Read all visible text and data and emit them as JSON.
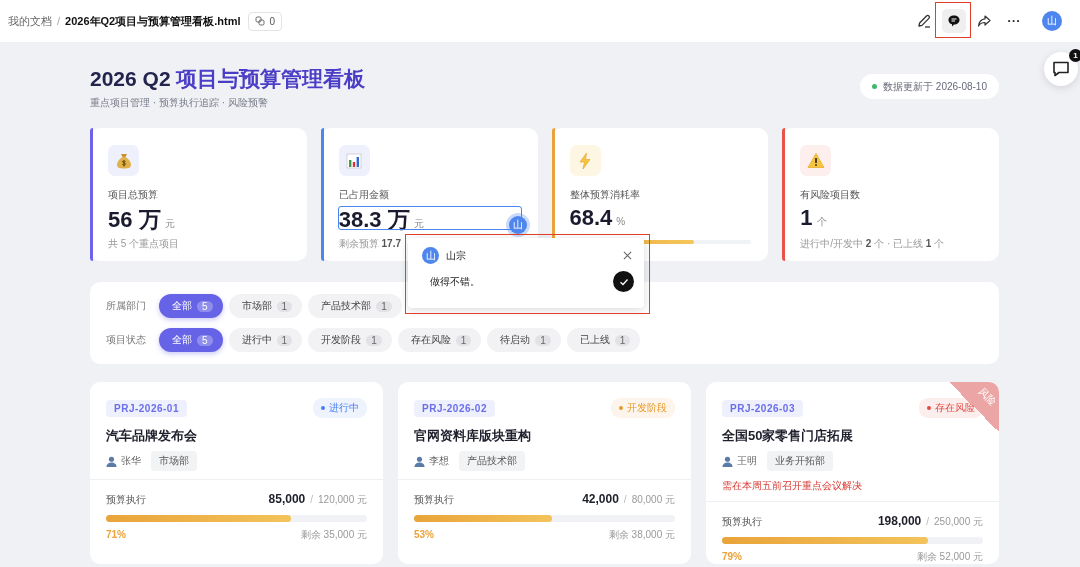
{
  "topbar": {
    "breadcrumb_root": "我的文档",
    "separator": "/",
    "file_name": "2026年Q2项目与预算管理看板.html",
    "link_count": "0",
    "tools": [
      {
        "kind": "edit",
        "selected": false
      },
      {
        "kind": "comment",
        "selected": true
      },
      {
        "kind": "share",
        "selected": false
      },
      {
        "kind": "more",
        "selected": false
      }
    ],
    "avatar": "山"
  },
  "comment_fab": {
    "badge": "1"
  },
  "header": {
    "title_part1": "2026 Q2",
    "title_part2": "项目与预算管理看板",
    "subtitle": "重点项目管理 · 预算执行追踪 · 风险预警",
    "updated": "数据更新于 2026-08-10"
  },
  "kpis": [
    {
      "color": "#6c63e8",
      "label": "项目总预算",
      "value": "56 万",
      "unit": "元",
      "sub": "共 5 个重点项目"
    },
    {
      "color": "#4a86f0",
      "label": "已占用金额",
      "value": "38.3 万",
      "unit": "元",
      "sub": "剩余预算 **17.7**",
      "commented": true
    },
    {
      "color": "#eba23a",
      "label": "整体预算消耗率",
      "value": "68.4",
      "unit": "%",
      "level": 0.684
    },
    {
      "color": "#e5534b",
      "label": "有风险项目数",
      "value": "1",
      "unit": "个",
      "sub": "进行中/开发中 **2** 个 · 已上线 **1** 个"
    }
  ],
  "filters": [
    {
      "label": "所属部门",
      "chips": [
        {
          "label": "全部",
          "count": "5",
          "selected": true
        },
        {
          "label": "市场部",
          "count": "1",
          "selected": false
        },
        {
          "label": "产品技术部",
          "count": "1",
          "selected": false
        }
      ]
    },
    {
      "label": "项目状态",
      "chips": [
        {
          "label": "全部",
          "count": "5",
          "selected": true
        },
        {
          "label": "进行中",
          "count": "1",
          "selected": false
        },
        {
          "label": "开发阶段",
          "count": "1",
          "selected": false
        },
        {
          "label": "存在风险",
          "count": "1",
          "selected": false
        },
        {
          "label": "待启动",
          "count": "1",
          "selected": false
        },
        {
          "label": "已上线",
          "count": "1",
          "selected": false
        }
      ]
    }
  ],
  "projects": [
    {
      "id": "PRJ-2026-01",
      "status": "进行中",
      "color": "#4a7ef0",
      "title": "汽车品牌发布会",
      "owner": "张华",
      "dept": "市场部",
      "budget_label": "预算执行",
      "spent": "85,000",
      "slash": "/",
      "total": "120,000 元",
      "level": 0.71,
      "percent": "71%",
      "remaining": "剩余 35,000 元"
    },
    {
      "id": "PRJ-2026-02",
      "status": "开发阶段",
      "color": "#e59a2c",
      "title": "官网资料库版块重构",
      "owner": "李想",
      "dept": "产品技术部",
      "budget_label": "预算执行",
      "spent": "42,000",
      "slash": "/",
      "total": "80,000 元",
      "level": 0.53,
      "percent": "53%",
      "remaining": "剩余 38,000 元"
    },
    {
      "id": "PRJ-2026-03",
      "status": "存在风险",
      "color": "#df4a45",
      "ribbon": "风险",
      "title": "全国50家零售门店拓展",
      "owner": "王明",
      "dept": "业务开拓部",
      "note": "需在本周五前召开重点会议解决",
      "budget_label": "预算执行",
      "spent": "198,000",
      "slash": "/",
      "total": "250,000 元",
      "level": 0.79,
      "percent": "79%",
      "remaining": "剩余 52,000 元"
    }
  ],
  "comment_popup": {
    "avatar": "山",
    "badge_avatar": "山",
    "author": "山宗",
    "value": "做得不错。"
  }
}
